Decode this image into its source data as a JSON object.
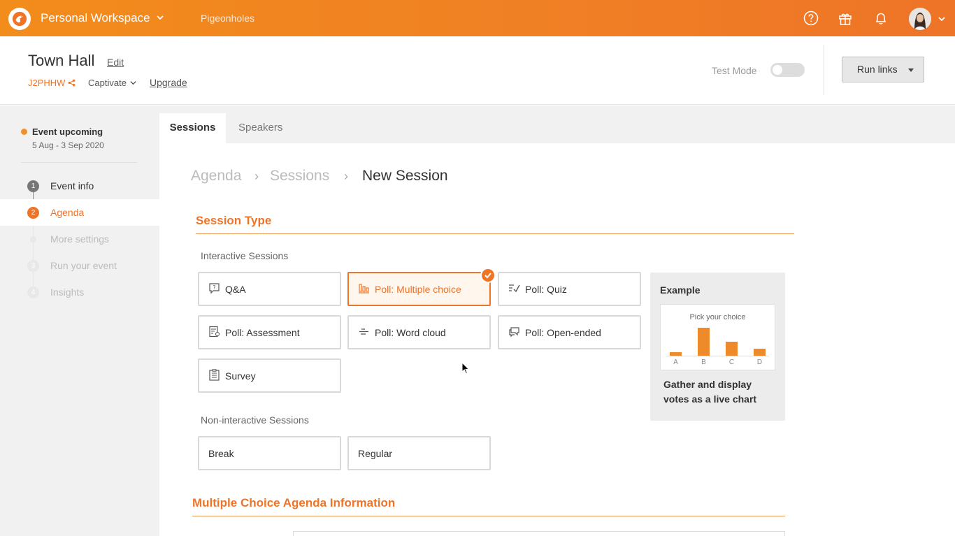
{
  "topbar": {
    "workspace_name": "Personal Workspace",
    "nav_pigeonholes": "Pigeonholes",
    "icons": [
      "help-icon",
      "gift-icon",
      "bell-icon"
    ]
  },
  "header": {
    "event_title": "Town Hall",
    "edit_label": "Edit",
    "event_code": "J2PHHW",
    "plan": "Captivate",
    "upgrade_label": "Upgrade",
    "test_mode_label": "Test Mode",
    "run_links_label": "Run links"
  },
  "sidebar": {
    "status": "Event upcoming",
    "dates": "5 Aug - 3 Sep 2020",
    "steps": [
      {
        "num": "1",
        "label": "Event info"
      },
      {
        "num": "2",
        "label": "Agenda"
      },
      {
        "num": "",
        "label": "More settings"
      },
      {
        "num": "3",
        "label": "Run your event"
      },
      {
        "num": "4",
        "label": "Insights"
      }
    ]
  },
  "tabs": [
    {
      "label": "Sessions"
    },
    {
      "label": "Speakers"
    }
  ],
  "breadcrumb": [
    "Agenda",
    "Sessions",
    "New Session"
  ],
  "session_type": {
    "title": "Session Type",
    "interactive_label": "Interactive Sessions",
    "interactive": [
      {
        "label": "Q&A",
        "icon": "qa-icon"
      },
      {
        "label": "Poll: Multiple choice",
        "icon": "bar-chart-icon"
      },
      {
        "label": "Poll: Quiz",
        "icon": "quiz-icon"
      },
      {
        "label": "Poll: Assessment",
        "icon": "assessment-icon"
      },
      {
        "label": "Poll: Word cloud",
        "icon": "word-cloud-icon"
      },
      {
        "label": "Poll: Open-ended",
        "icon": "open-ended-icon"
      },
      {
        "label": "Survey",
        "icon": "survey-icon"
      }
    ],
    "selected": "Poll: Multiple choice",
    "non_interactive_label": "Non-interactive Sessions",
    "non_interactive": [
      {
        "label": "Break"
      },
      {
        "label": "Regular"
      }
    ]
  },
  "example": {
    "title": "Example",
    "question": "Pick your choice",
    "description": "Gather and display votes as a live chart",
    "chart_data": {
      "type": "bar",
      "categories": [
        "A",
        "B",
        "C",
        "D"
      ],
      "values": [
        1,
        8,
        4,
        2
      ]
    }
  },
  "multiple_choice_section": {
    "title": "Multiple Choice Agenda Information"
  },
  "colors": {
    "accent": "#ee7427",
    "topbar": "#f28c1b",
    "status_dot": "#f0922a"
  }
}
